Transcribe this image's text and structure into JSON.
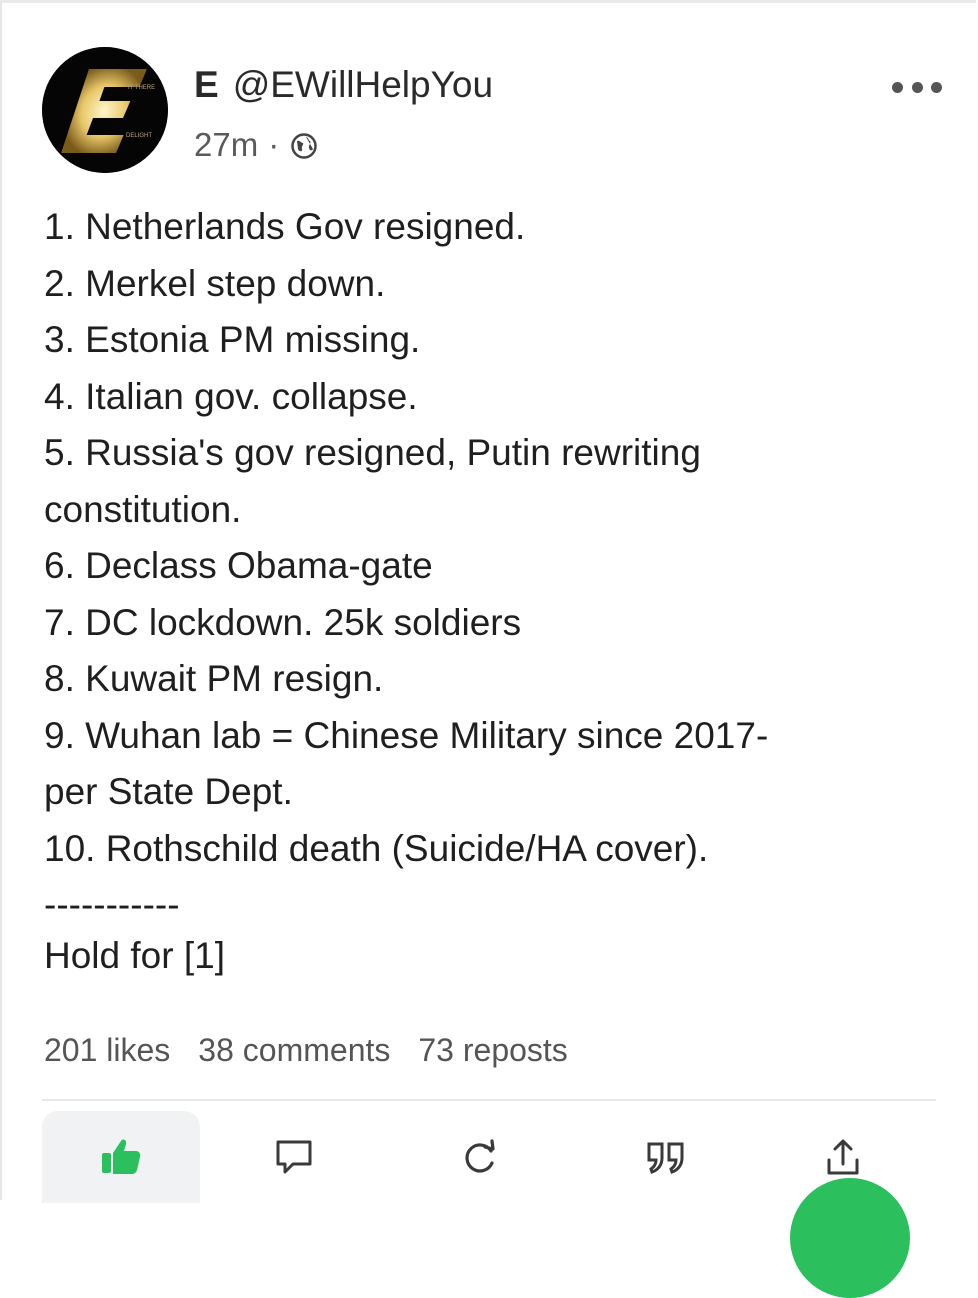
{
  "author": {
    "display_name": "E",
    "handle": "@EWillHelpYou",
    "avatar_letter": "E",
    "avatar_tagline_top": "IT THERE",
    "avatar_tagline_bottom": "DELIGHT"
  },
  "meta": {
    "time_ago": "27m",
    "separator": "·",
    "visibility_icon": "globe-icon"
  },
  "post": {
    "lines": [
      "1. Netherlands Gov resigned.",
      "2. Merkel step down.",
      "3. Estonia PM missing.",
      "4. Italian gov. collapse.",
      "5. Russia's gov resigned, Putin rewriting",
      "constitution.",
      "6. Declass Obama-gate",
      "7. DC lockdown. 25k soldiers",
      "8. Kuwait PM resign.",
      "9. Wuhan lab = Chinese Military since 2017-",
      "per State Dept.",
      "10. Rothschild death (Suicide/HA cover).",
      "-----------"
    ],
    "footer": "Hold for [1]"
  },
  "stats": {
    "likes": "201 likes",
    "comments": "38 comments",
    "reposts": "73 reposts"
  },
  "actions": {
    "like_icon": "thumbs-up-icon",
    "comment_icon": "comment-icon",
    "repost_icon": "repost-icon",
    "quote_icon": "quote-icon",
    "share_icon": "share-icon"
  },
  "colors": {
    "accent": "#2bbf5e",
    "text": "#1f1f1f",
    "muted": "#555555"
  }
}
